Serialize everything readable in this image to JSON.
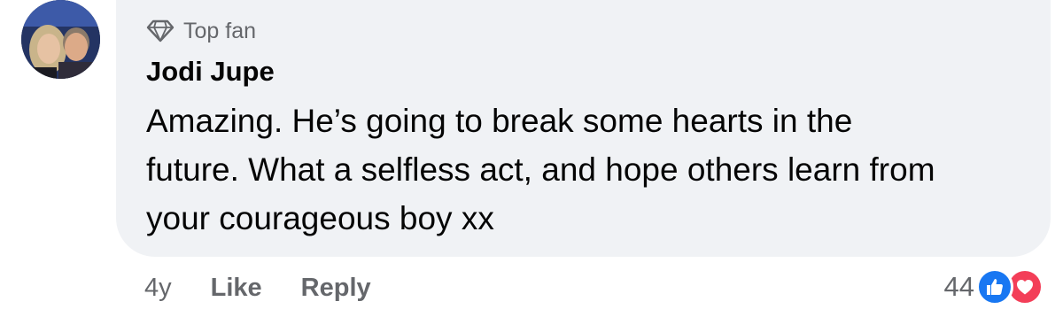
{
  "comment": {
    "badge_label": "Top fan",
    "author_name": "Jodi Jupe",
    "text_lines": [
      "Amazing. He’s going to break some hearts in the",
      "future. What a selfless act, and hope others learn from",
      "your courageous boy xx"
    ],
    "time_ago": "4y",
    "like_label": "Like",
    "reply_label": "Reply",
    "reaction_count": "44",
    "reactions": [
      "like-reaction-icon",
      "love-reaction-icon"
    ]
  },
  "colors": {
    "bubble_bg": "#f0f2f5",
    "secondary_text": "#65676b",
    "primary_text": "#050505",
    "like_blue": "#1877f2",
    "love_red": "#f33e58"
  }
}
